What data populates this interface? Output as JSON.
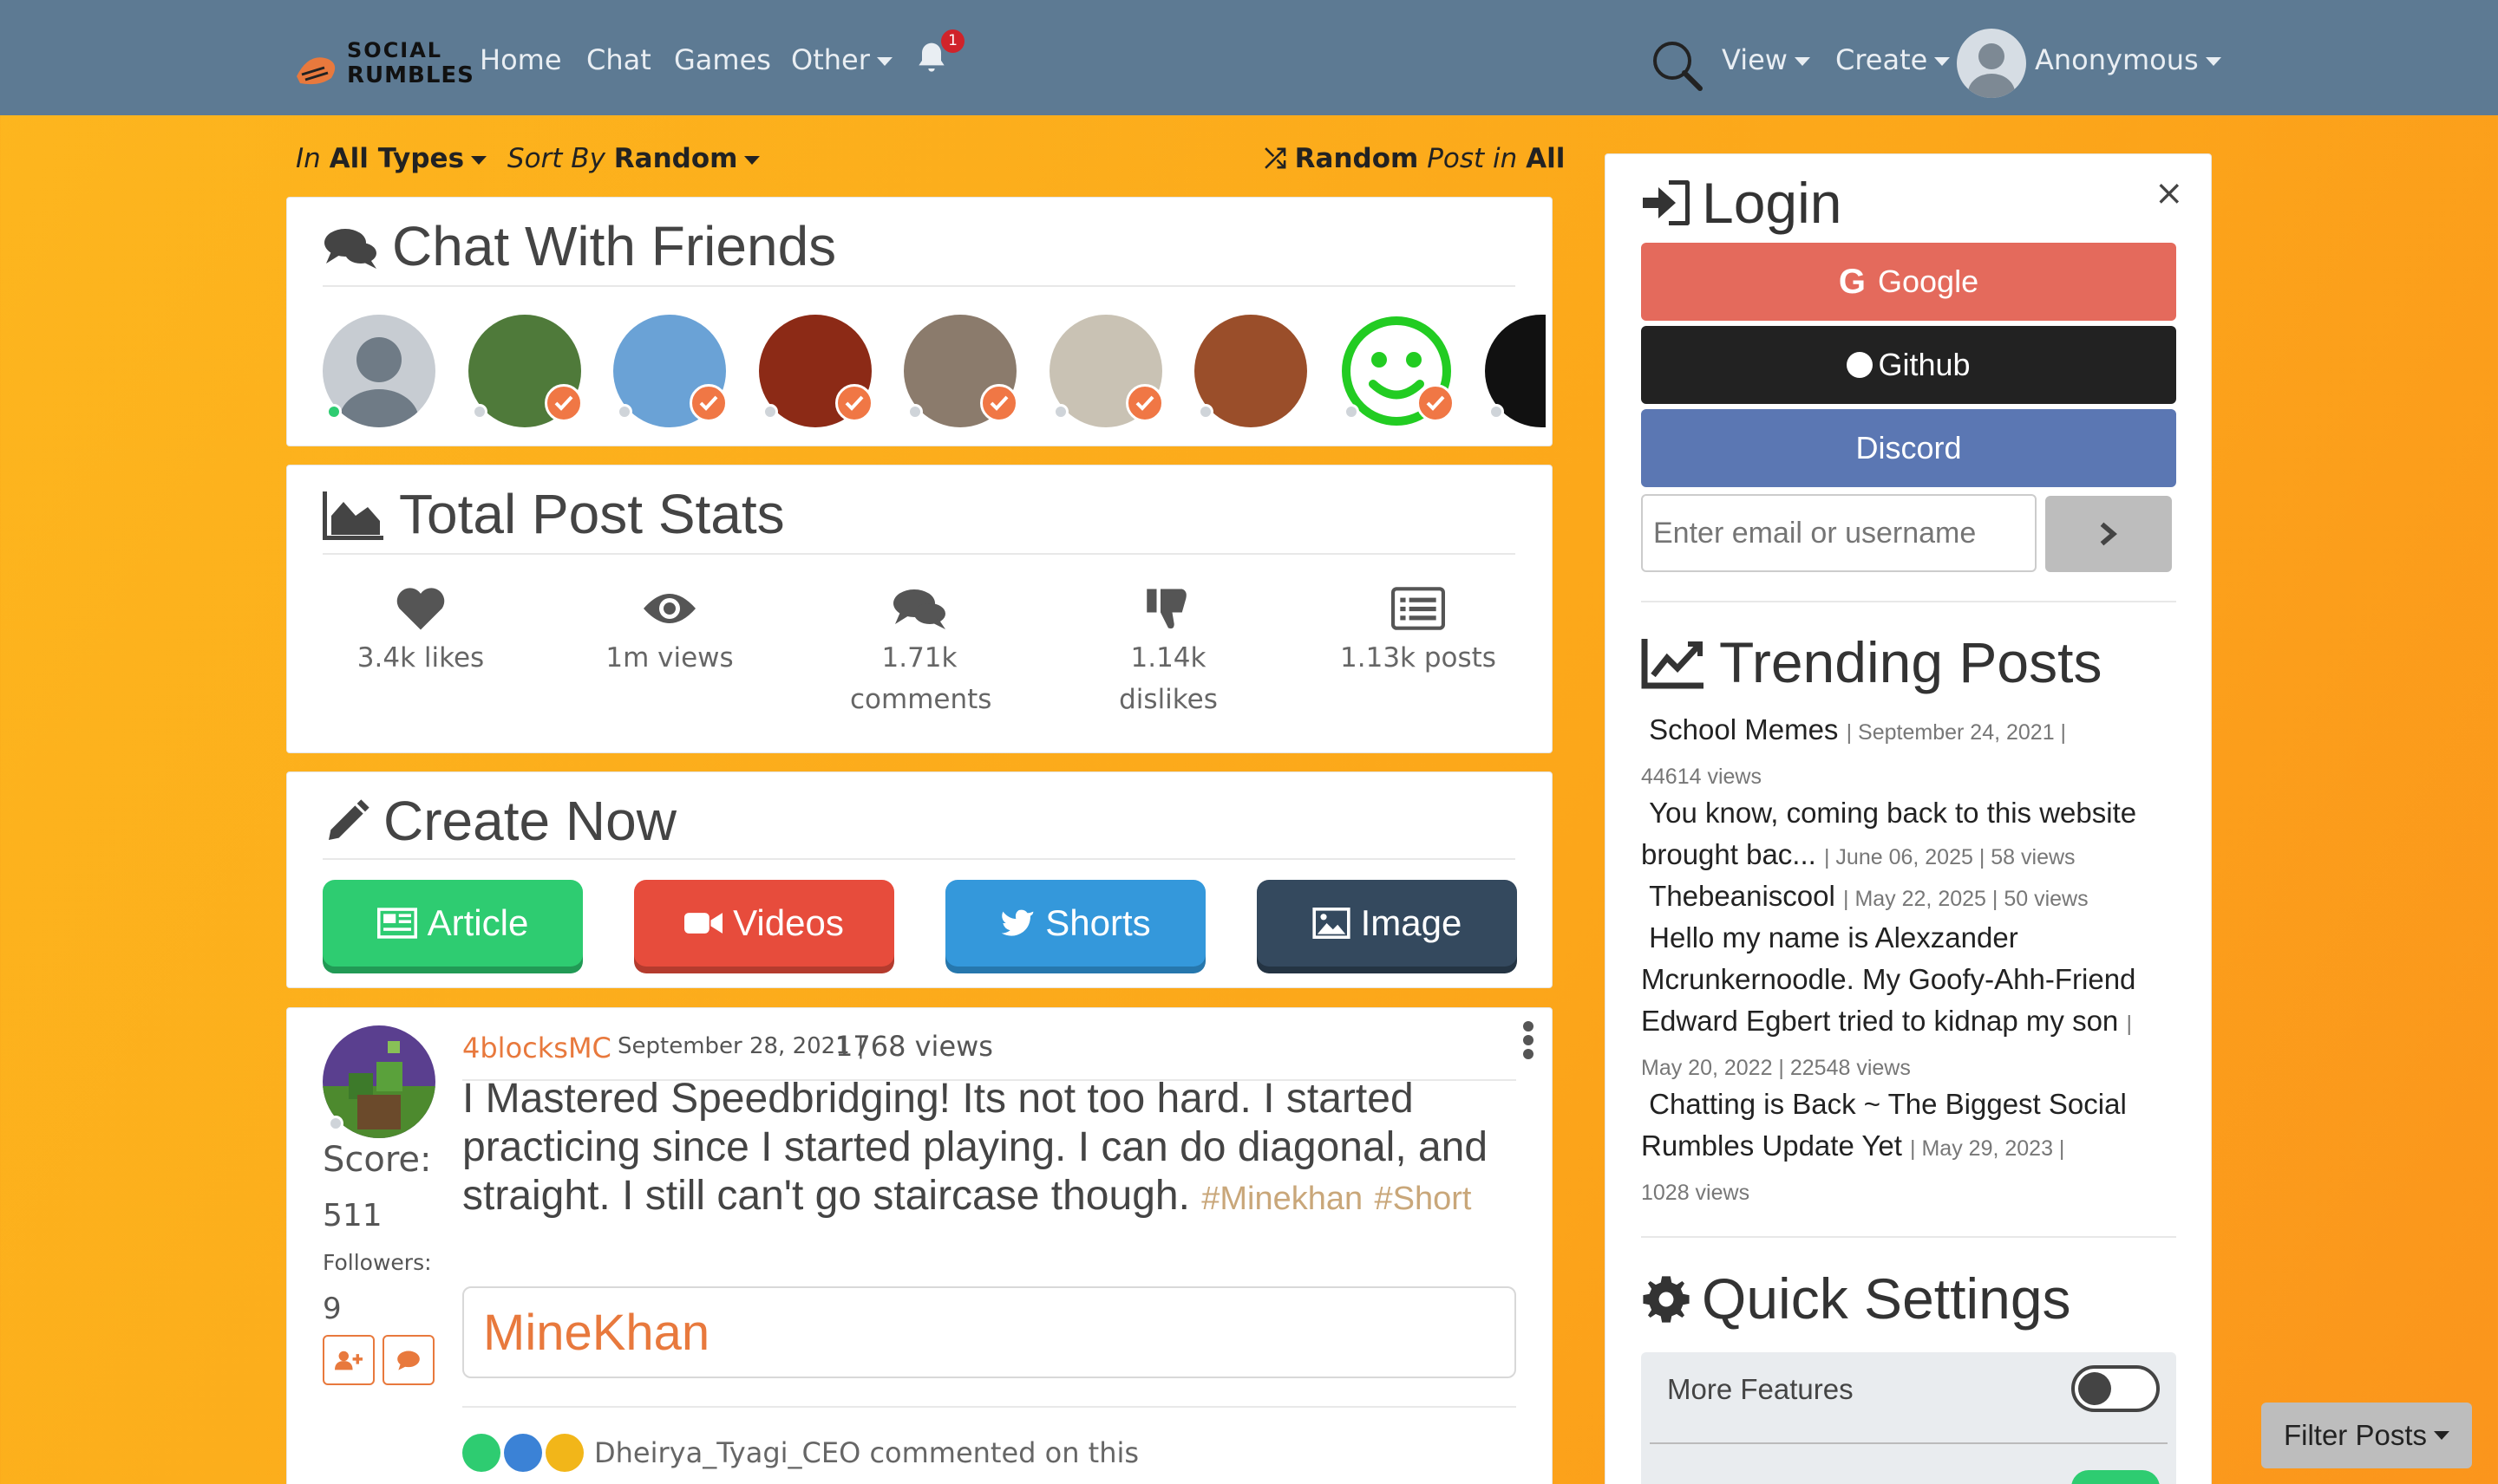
{
  "nav": {
    "logo_line1": "SOCIAL",
    "logo_line2": "RUMBLES",
    "links": [
      "Home",
      "Chat",
      "Games",
      "Other"
    ],
    "notif_count": "1",
    "right": {
      "view": "View",
      "create": "Create",
      "user": "Anonymous"
    }
  },
  "toolbar": {
    "in": "In",
    "types": "All Types",
    "sort_by": "Sort By",
    "sort": "Random",
    "random": "Random",
    "post_in": "Post in",
    "all": "All"
  },
  "chat": {
    "title": "Chat With Friends",
    "friends": [
      {
        "status": "online",
        "verified": false,
        "color": "#c7ccd2"
      },
      {
        "status": "offline",
        "verified": true,
        "color": "#4f7a3a"
      },
      {
        "status": "offline",
        "verified": true,
        "color": "#6aa2d6"
      },
      {
        "status": "offline",
        "verified": true,
        "color": "#8c2a16"
      },
      {
        "status": "offline",
        "verified": true,
        "color": "#8b7b6c"
      },
      {
        "status": "offline",
        "verified": true,
        "color": "#c9c2b4"
      },
      {
        "status": "offline",
        "verified": false,
        "color": "#9a4e2a"
      },
      {
        "status": "offline",
        "verified": true,
        "color": "#ffffff"
      },
      {
        "status": "offline",
        "verified": false,
        "color": "#111111"
      }
    ]
  },
  "stats": {
    "title": "Total Post Stats",
    "items": [
      {
        "icon": "heart-icon",
        "label": "3.4k likes"
      },
      {
        "icon": "eye-icon",
        "label": "1m views"
      },
      {
        "icon": "comments-icon",
        "label": "1.71k comments"
      },
      {
        "icon": "thumbs-down-icon",
        "label": "1.14k dislikes"
      },
      {
        "icon": "list-icon",
        "label": "1.13k posts"
      }
    ]
  },
  "create": {
    "title": "Create Now",
    "buttons": [
      {
        "label": "Article",
        "color": "#2ecc71",
        "shadow": "#219a55"
      },
      {
        "label": "Videos",
        "color": "#e74c3c",
        "shadow": "#b43b2e"
      },
      {
        "label": "Shorts",
        "color": "#3498db",
        "shadow": "#2677ad"
      },
      {
        "label": "Image",
        "color": "#34495e",
        "shadow": "#243443"
      }
    ]
  },
  "post": {
    "user": "4blocksMC",
    "date": "September 28, 2021",
    "views": "1768 views",
    "score_label": "Score:",
    "score": "511",
    "followers_label": "Followers:",
    "followers": "9",
    "body": "I Mastered Speedbridging! Its not too hard. I started practicing since I started playing. I can do diagonal, and straight. I still can't go staircase though.",
    "tag1": "#Minekhan",
    "tag2": "#Short",
    "embed": "MineKhan",
    "comment_line": "Dheirya_Tyagi_CEO commented on this"
  },
  "login": {
    "title": "Login",
    "close": "×",
    "google": "Google",
    "github": "Github",
    "discord": "Discord",
    "placeholder": "Enter email or username"
  },
  "trending": {
    "title": "Trending Posts",
    "posts": [
      {
        "title": "School Memes",
        "meta": "| September 24, 2021 |",
        "views": "44614 views"
      },
      {
        "title": "You know, coming back to this website brought bac...",
        "meta": "| June 06, 2025 | 58 views"
      },
      {
        "title": "Thebeaniscool",
        "meta": "| May 22, 2025 | 50 views"
      },
      {
        "title": "Hello my name is Alexzander Mcrunkernoodle. My Goofy-Ahh-Friend Edward Egbert tried to kidnap my son",
        "meta": "|",
        "views": "May 20, 2022 | 22548 views"
      },
      {
        "title": "Chatting is Back ~ The Biggest Social Rumbles Update Yet",
        "meta": "| May 29, 2023 |",
        "views": "1028 views"
      }
    ]
  },
  "quick": {
    "title": "Quick Settings",
    "more_features": "More Features"
  },
  "filter": "Filter Posts"
}
